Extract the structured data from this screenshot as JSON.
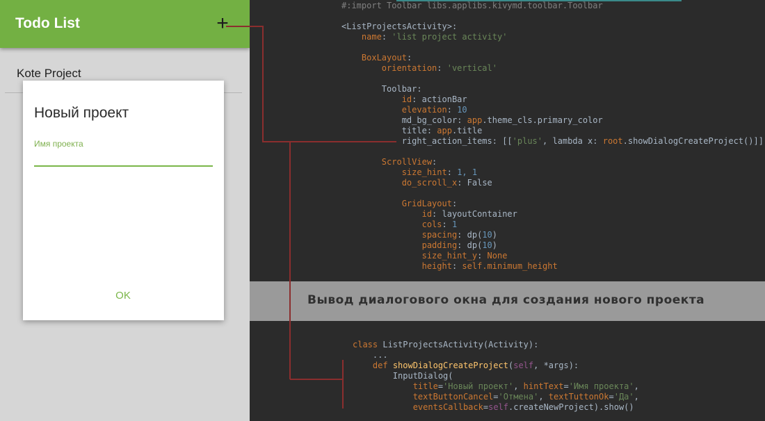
{
  "app": {
    "toolbar": {
      "title": "Todo List",
      "add_icon": "+"
    },
    "list": {
      "items": [
        {
          "label": "Kote Project"
        }
      ]
    },
    "dialog": {
      "title": "Новый проект",
      "field_label": "Имя проекта",
      "field_value": "",
      "ok_label": "OK"
    }
  },
  "banner": {
    "text": "Вывод диалогового окна для создания нового проекта"
  },
  "code_top": {
    "line1": "#:import Toolbar libs.applibs.kivymd.toolbar.Toolbar",
    "line2": "<ListProjectsActivity>:",
    "line3_key": "name",
    "line3_val": "'list project activity'",
    "line4": "BoxLayout",
    "line5_key": "orientation",
    "line5_val": "'vertical'",
    "line6": "Toolbar",
    "line7_key": "id",
    "line7_val": "actionBar",
    "line8_key": "elevation",
    "line8_val": "10",
    "line9_key": "md_bg_color",
    "line9_a": "app",
    "line9_b": ".theme_cls.primary_color",
    "line10_key": "title",
    "line10_a": "app",
    "line10_b": ".title",
    "line11_key": "right_action_items",
    "line11_a": "[[",
    "line11_b": "'plus'",
    "line11_c": ", lambda x: ",
    "line11_d": "root",
    "line11_e": ".showDialogCreateProject()]]",
    "line12": "ScrollView",
    "line13_key": "size_hint",
    "line13_val": "1, 1",
    "line14_key": "do_scroll_x",
    "line14_val": "False",
    "line15": "GridLayout",
    "line16_key": "id",
    "line16_val": "layoutContainer",
    "line17_key": "cols",
    "line17_val": "1",
    "line18_key": "spacing",
    "line18_a": "dp(",
    "line18_b": "10",
    "line18_c": ")",
    "line19_key": "padding",
    "line19_a": "dp(",
    "line19_b": "10",
    "line19_c": ")",
    "line20_key": "size_hint_y",
    "line20_val": "None",
    "line21_key": "height",
    "line21_a": "self",
    "line21_b": ".minimum_height"
  },
  "code_bottom": {
    "l1_kw": "class ",
    "l1_rest": "ListProjectsActivity(Activity):",
    "l2": "...",
    "l3_kw": "def ",
    "l3_fn": "showDialogCreateProject",
    "l3_a": "(",
    "l3_self": "self",
    "l3_b": ", *args):",
    "l4": "InputDialog(",
    "l5_k1": "title",
    "l5_v1": "'Новый проект'",
    "l5_k2": "hintText",
    "l5_v2": "'Имя проекта'",
    "l6_k1": "textButtonCancel",
    "l6_v1": "'Отмена'",
    "l6_k2": "textTuttonOk",
    "l6_v2": "'Да'",
    "l7_k1": "eventsCallback",
    "l7_self": "self",
    "l7_rest": ".createNewProject).show()"
  },
  "colors": {
    "toolbar": "#73b043",
    "accent": "#7ab648",
    "connector": "#8b2e2e",
    "code_bg": "#2b2b2b",
    "banner_bg": "#9a9a9a"
  }
}
